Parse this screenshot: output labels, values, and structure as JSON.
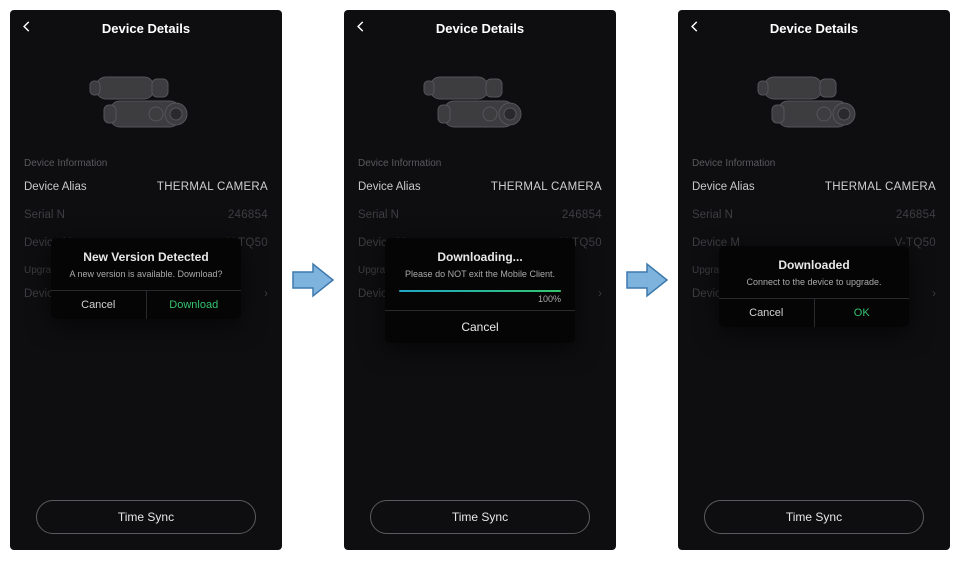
{
  "common": {
    "page_title": "Device Details",
    "device_info_label": "Device Information",
    "upgrade_label": "Upgrade",
    "time_sync_label": "Time Sync",
    "rows": {
      "alias_label": "Device Alias",
      "alias_value": "THERMAL CAMERA",
      "serial_label_full": "Serial Number",
      "serial_value_tail": "246854",
      "model_label_full": "Device Model",
      "model_value_tail": "V-TQ50",
      "upgrade_row": "Device Upgrade"
    }
  },
  "screen1": {
    "serial_label_clip": "Serial N",
    "model_label_clip": "Device M",
    "dialog": {
      "title": "New Version Detected",
      "msg": "A new version is available. Download?",
      "cancel": "Cancel",
      "download": "Download"
    }
  },
  "screen2": {
    "serial_label_clip": "Serial N",
    "model_label_clip": "Device M",
    "upgrade_row_clip": "Device U",
    "dialog": {
      "title": "Downloading...",
      "msg": "Please do NOT exit the Mobile Client.",
      "pct_label": "100%",
      "pct_value": 100,
      "cancel": "Cancel"
    }
  },
  "screen3": {
    "serial_label_clip": "Serial N",
    "model_label_clip": "Device M",
    "dialog": {
      "title": "Downloaded",
      "msg": "Connect to the device to upgrade.",
      "cancel": "Cancel",
      "ok": "OK"
    }
  }
}
